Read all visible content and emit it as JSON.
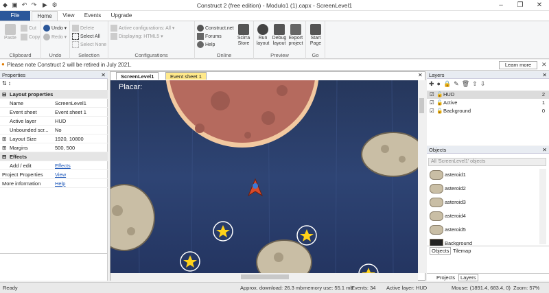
{
  "window": {
    "title": "Construct 2  (free edition) - Modulo1 (1).capx - ScreenLevel1"
  },
  "tabs": [
    "File",
    "Home",
    "View",
    "Events",
    "Upgrade"
  ],
  "ribbon": {
    "clipboard": {
      "label": "Clipboard",
      "paste": "Paste",
      "cut": "Cut",
      "copy": "Copy"
    },
    "undo": {
      "label": "Undo",
      "undo": "Undo",
      "redo": "Redo"
    },
    "selection": {
      "label": "Selection",
      "delete": "Delete",
      "select_all": "Select All",
      "select_none": "Select None"
    },
    "configurations": {
      "label": "Configurations",
      "active": "Active configurations: All",
      "displaying": "Displaying:",
      "displaying_value": "HTML5"
    },
    "online": {
      "label": "Online",
      "construct": "Construct.net",
      "forums": "Forums",
      "help": "Help",
      "store": "Scirra Store"
    },
    "preview": {
      "label": "Preview",
      "run": "Run layout",
      "debug": "Debug layout",
      "export": "Export project"
    },
    "go": {
      "label": "Go",
      "start": "Start Page"
    }
  },
  "notice": {
    "text": "Please note Construct 2 will be retired in July 2021.",
    "button": "Learn more"
  },
  "properties": {
    "title": "Properties",
    "cat_layout": "Layout properties",
    "rows": [
      {
        "k": "Name",
        "v": "ScreenLevel1"
      },
      {
        "k": "Event sheet",
        "v": "Event sheet 1"
      },
      {
        "k": "Active layer",
        "v": "HUD"
      },
      {
        "k": "Unbounded scr...",
        "v": "No"
      },
      {
        "k": "Layout Size",
        "v": "1920, 10800"
      },
      {
        "k": "Margins",
        "v": "500, 500"
      }
    ],
    "cat_effects": "Effects",
    "add_edit": "Add / edit",
    "effects_link": "Effects",
    "project_props": "Project Properties",
    "view_link": "View",
    "more_info": "More information",
    "help_link": "Help"
  },
  "doc_tabs": [
    "ScreenLevel1",
    "Event sheet 1"
  ],
  "canvas": {
    "hud_text": "Placar:"
  },
  "layers": {
    "title": "Layers",
    "items": [
      {
        "name": "HUD",
        "n": "2"
      },
      {
        "name": "Active",
        "n": "1"
      },
      {
        "name": "Background",
        "n": "0"
      }
    ]
  },
  "objects": {
    "title": "Objects",
    "filter_placeholder": "All 'ScreenLevel1' objects",
    "items": [
      "asteroid1",
      "asteroid2",
      "asteroid3",
      "asteroid4",
      "asteroid5",
      "Background"
    ],
    "tabs": [
      "Objects",
      "Tilemap"
    ]
  },
  "bottom_tabs": [
    "Projects",
    "Layers"
  ],
  "status": {
    "ready": "Ready",
    "download": "Approx. download: 26.3 mb",
    "memory": "memory use: 55.1 mb",
    "events": "Events: 34",
    "active_layer": "Active layer: HUD",
    "mouse": "Mouse: (1891.4, 683.4, 0)",
    "zoom": "Zoom: 57%"
  },
  "colors": {
    "accent": "#2b579a",
    "planet": "#b56a5e",
    "space": "#2e4474",
    "star": "#ffd21a"
  }
}
